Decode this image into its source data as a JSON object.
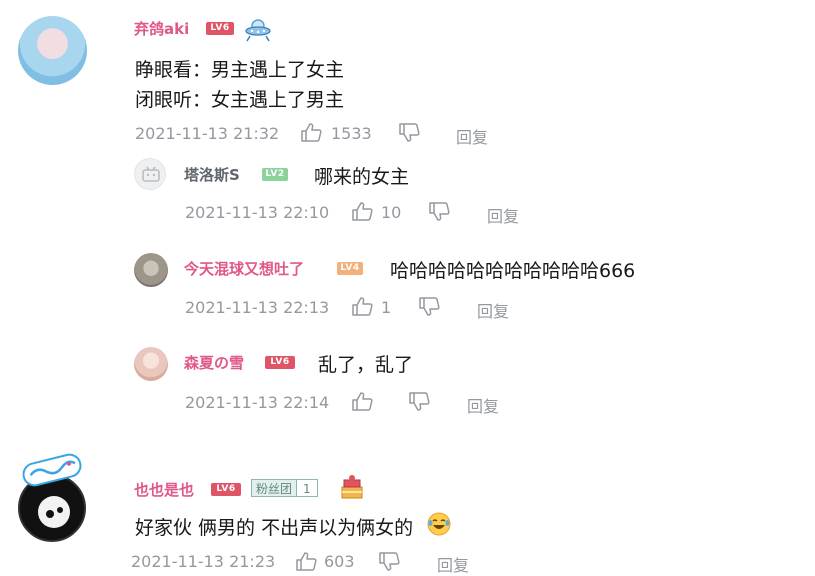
{
  "comments": [
    {
      "username": "弃鸽aki",
      "level": "LV6",
      "content_lines": [
        "睁眼看：男主遇上了女主",
        "闭眼听：女主遇上了男主"
      ],
      "time": "2021-11-13 21:32",
      "likes": "1533",
      "reply_label": "回复",
      "replies": [
        {
          "username": "塔洛斯S",
          "level": "LV2",
          "content": "哪来的女主",
          "time": "2021-11-13 22:10",
          "likes": "10",
          "reply_label": "回复"
        },
        {
          "username": "今天混球又想吐了",
          "level": "LV4",
          "content": "哈哈哈哈哈哈哈哈哈哈哈666",
          "time": "2021-11-13 22:13",
          "likes": "1",
          "reply_label": "回复"
        },
        {
          "username": "森夏の雪",
          "level": "LV6",
          "content": "乱了，乱了",
          "time": "2021-11-13 22:14",
          "likes": "",
          "reply_label": "回复"
        }
      ]
    },
    {
      "username": "也也是也",
      "level": "LV6",
      "fan_badge": {
        "name": "粉丝团",
        "level": "1"
      },
      "content": "好家伙 俩男的 不出声以为俩女的",
      "time": "2021-11-13 21:23",
      "likes": "603",
      "reply_label": "回复"
    }
  ],
  "icons": {
    "like": "thumbs-up-icon",
    "dislike": "thumbs-down-icon",
    "emoji": "laughing-tears-emoji",
    "decoration_1": "ufo-decoration-icon",
    "decoration_2": "cake-decoration-icon"
  },
  "colors": {
    "username_pink": "#e0588a",
    "username_gray": "#61666d",
    "meta_gray": "#9499a0",
    "lv6": "#e05566",
    "lv2": "#8bd29b",
    "lv4": "#f3b07a"
  }
}
